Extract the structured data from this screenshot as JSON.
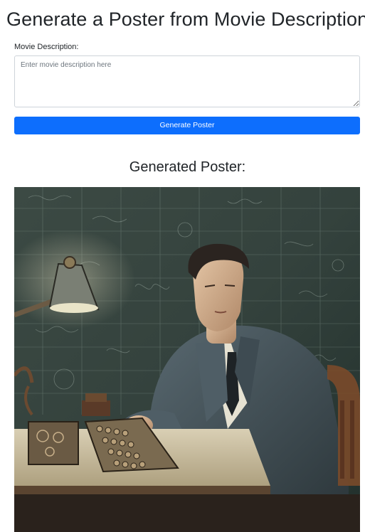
{
  "header": {
    "title": "Generate a Poster from Movie Description"
  },
  "form": {
    "description_label": "Movie Description:",
    "description_value": "",
    "description_placeholder": "Enter movie description here",
    "generate_label": "Generate Poster"
  },
  "result": {
    "heading": "Generated Poster:",
    "image_alt": "Generated poster showing a man in a suit typing on a mechanical machine beside a desk lamp in front of a chalkboard covered in equations"
  },
  "colors": {
    "primary": "#0d6efd",
    "text": "#212529"
  }
}
